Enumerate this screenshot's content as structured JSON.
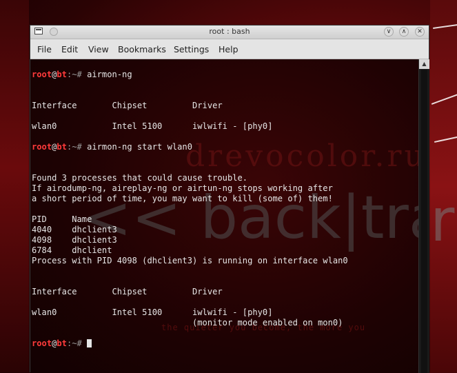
{
  "window": {
    "title": "root : bash"
  },
  "titlebar": {
    "buttons": [
      "chevron-down-icon",
      "chevron-up-icon",
      "close-icon"
    ]
  },
  "menubar": {
    "items": [
      {
        "label": "File"
      },
      {
        "label": "Edit"
      },
      {
        "label": "View"
      },
      {
        "label": "Bookmarks"
      },
      {
        "label": "Settings"
      },
      {
        "label": "Help"
      }
    ]
  },
  "prompt": {
    "user": "root",
    "at": "@",
    "host": "bt",
    "sep": ":~# "
  },
  "terminal": {
    "lines": [
      {
        "type": "blank",
        "text": ""
      },
      {
        "type": "prompt",
        "cmd": "airmon-ng"
      },
      {
        "type": "blank",
        "text": ""
      },
      {
        "type": "blank",
        "text": ""
      },
      {
        "type": "out",
        "text": "Interface       Chipset         Driver"
      },
      {
        "type": "blank",
        "text": ""
      },
      {
        "type": "out",
        "text": "wlan0           Intel 5100      iwlwifi - [phy0]"
      },
      {
        "type": "blank",
        "text": ""
      },
      {
        "type": "prompt",
        "cmd": "airmon-ng start wlan0"
      },
      {
        "type": "blank",
        "text": ""
      },
      {
        "type": "blank",
        "text": ""
      },
      {
        "type": "out",
        "text": "Found 3 processes that could cause trouble."
      },
      {
        "type": "out",
        "text": "If airodump-ng, aireplay-ng or airtun-ng stops working after"
      },
      {
        "type": "out",
        "text": "a short period of time, you may want to kill (some of) them!"
      },
      {
        "type": "blank",
        "text": ""
      },
      {
        "type": "out",
        "text": "PID     Name"
      },
      {
        "type": "out",
        "text": "4040    dhclient3"
      },
      {
        "type": "out",
        "text": "4098    dhclient3"
      },
      {
        "type": "out",
        "text": "6784    dhclient"
      },
      {
        "type": "out",
        "text": "Process with PID 4098 (dhclient3) is running on interface wlan0"
      },
      {
        "type": "blank",
        "text": ""
      },
      {
        "type": "blank",
        "text": ""
      },
      {
        "type": "out",
        "text": "Interface       Chipset         Driver"
      },
      {
        "type": "blank",
        "text": ""
      },
      {
        "type": "out",
        "text": "wlan0           Intel 5100      iwlwifi - [phy0]"
      },
      {
        "type": "out",
        "text": "                                (monitor mode enabled on mon0)"
      },
      {
        "type": "blank",
        "text": ""
      },
      {
        "type": "prompt_cursor",
        "cmd": ""
      }
    ]
  },
  "watermarks": {
    "site": "drevocolor.ru",
    "logo": "<< back|tra",
    "tagline": "the quieter you become, the more you"
  },
  "colors": {
    "prompt_red": "#ff3b3b",
    "terminal_text": "#e6e6e6",
    "desktop_red": "#8a0f12"
  }
}
